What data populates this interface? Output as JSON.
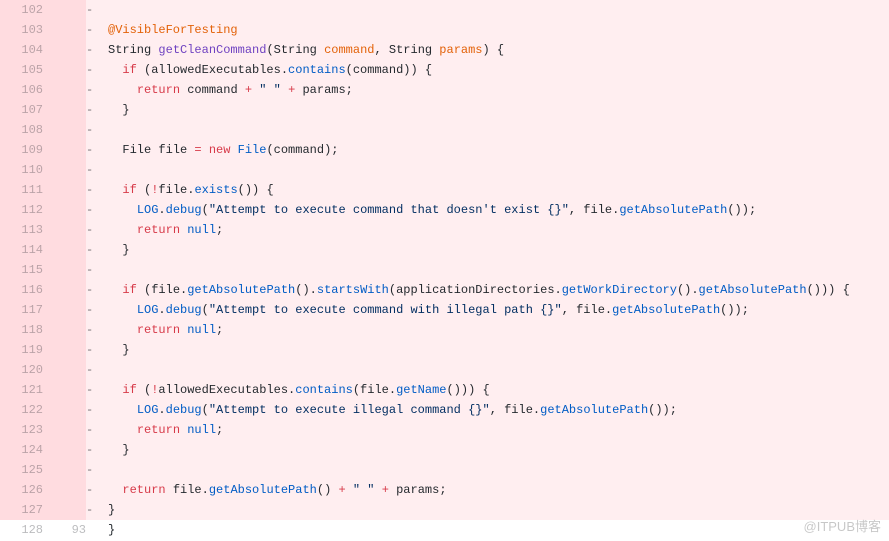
{
  "watermark": "@ITPUB博客",
  "rows": [
    {
      "ln_old": "102",
      "ln_new": "",
      "type": "del",
      "tokens": [
        [
          "marker",
          "-   "
        ]
      ]
    },
    {
      "ln_old": "103",
      "ln_new": "",
      "type": "del",
      "tokens": [
        [
          "marker",
          "-   "
        ],
        [
          "ann",
          "@VisibleForTesting"
        ]
      ]
    },
    {
      "ln_old": "104",
      "ln_new": "",
      "type": "del",
      "tokens": [
        [
          "marker",
          "-   "
        ],
        [
          "plain",
          "String "
        ],
        [
          "fn",
          "getCleanCommand"
        ],
        [
          "plain",
          "(String "
        ],
        [
          "param",
          "command"
        ],
        [
          "plain",
          ", String "
        ],
        [
          "param",
          "params"
        ],
        [
          "plain",
          ") {"
        ]
      ]
    },
    {
      "ln_old": "105",
      "ln_new": "",
      "type": "del",
      "tokens": [
        [
          "marker",
          "-   "
        ],
        [
          "plain",
          "  "
        ],
        [
          "ret",
          "if"
        ],
        [
          "plain",
          " (allowedExecutables."
        ],
        [
          "call",
          "contains"
        ],
        [
          "plain",
          "(command)) {"
        ]
      ]
    },
    {
      "ln_old": "106",
      "ln_new": "",
      "type": "del",
      "tokens": [
        [
          "marker",
          "-   "
        ],
        [
          "plain",
          "    "
        ],
        [
          "ret",
          "return"
        ],
        [
          "plain",
          " command "
        ],
        [
          "ret",
          "+"
        ],
        [
          "plain",
          " "
        ],
        [
          "str",
          "\" \""
        ],
        [
          "plain",
          " "
        ],
        [
          "ret",
          "+"
        ],
        [
          "plain",
          " params;"
        ]
      ]
    },
    {
      "ln_old": "107",
      "ln_new": "",
      "type": "del",
      "tokens": [
        [
          "marker",
          "-   "
        ],
        [
          "plain",
          "  }"
        ]
      ]
    },
    {
      "ln_old": "108",
      "ln_new": "",
      "type": "del",
      "tokens": [
        [
          "marker",
          "-   "
        ]
      ]
    },
    {
      "ln_old": "109",
      "ln_new": "",
      "type": "del",
      "tokens": [
        [
          "marker",
          "-   "
        ],
        [
          "plain",
          "  File file "
        ],
        [
          "ret",
          "="
        ],
        [
          "plain",
          " "
        ],
        [
          "ret",
          "new"
        ],
        [
          "plain",
          " "
        ],
        [
          "call",
          "File"
        ],
        [
          "plain",
          "(command);"
        ]
      ]
    },
    {
      "ln_old": "110",
      "ln_new": "",
      "type": "del",
      "tokens": [
        [
          "marker",
          "-   "
        ]
      ]
    },
    {
      "ln_old": "111",
      "ln_new": "",
      "type": "del",
      "tokens": [
        [
          "marker",
          "-   "
        ],
        [
          "plain",
          "  "
        ],
        [
          "ret",
          "if"
        ],
        [
          "plain",
          " ("
        ],
        [
          "ret",
          "!"
        ],
        [
          "plain",
          "file."
        ],
        [
          "call",
          "exists"
        ],
        [
          "plain",
          "()) {"
        ]
      ]
    },
    {
      "ln_old": "112",
      "ln_new": "",
      "type": "del",
      "tokens": [
        [
          "marker",
          "-   "
        ],
        [
          "plain",
          "    "
        ],
        [
          "call",
          "LOG"
        ],
        [
          "plain",
          "."
        ],
        [
          "call",
          "debug"
        ],
        [
          "plain",
          "("
        ],
        [
          "str",
          "\"Attempt to execute command that doesn't exist {}\""
        ],
        [
          "plain",
          ", file."
        ],
        [
          "call",
          "getAbsolutePath"
        ],
        [
          "plain",
          "());"
        ]
      ]
    },
    {
      "ln_old": "113",
      "ln_new": "",
      "type": "del",
      "tokens": [
        [
          "marker",
          "-   "
        ],
        [
          "plain",
          "    "
        ],
        [
          "ret",
          "return"
        ],
        [
          "plain",
          " "
        ],
        [
          "call",
          "null"
        ],
        [
          "plain",
          ";"
        ]
      ]
    },
    {
      "ln_old": "114",
      "ln_new": "",
      "type": "del",
      "tokens": [
        [
          "marker",
          "-   "
        ],
        [
          "plain",
          "  }"
        ]
      ]
    },
    {
      "ln_old": "115",
      "ln_new": "",
      "type": "del",
      "tokens": [
        [
          "marker",
          "-   "
        ]
      ]
    },
    {
      "ln_old": "116",
      "ln_new": "",
      "type": "del",
      "tokens": [
        [
          "marker",
          "-   "
        ],
        [
          "plain",
          "  "
        ],
        [
          "ret",
          "if"
        ],
        [
          "plain",
          " (file."
        ],
        [
          "call",
          "getAbsolutePath"
        ],
        [
          "plain",
          "()."
        ],
        [
          "call",
          "startsWith"
        ],
        [
          "plain",
          "(applicationDirectories."
        ],
        [
          "call",
          "getWorkDirectory"
        ],
        [
          "plain",
          "()."
        ],
        [
          "call",
          "getAbsolutePath"
        ],
        [
          "plain",
          "())) {"
        ]
      ]
    },
    {
      "ln_old": "117",
      "ln_new": "",
      "type": "del",
      "tokens": [
        [
          "marker",
          "-   "
        ],
        [
          "plain",
          "    "
        ],
        [
          "call",
          "LOG"
        ],
        [
          "plain",
          "."
        ],
        [
          "call",
          "debug"
        ],
        [
          "plain",
          "("
        ],
        [
          "str",
          "\"Attempt to execute command with illegal path {}\""
        ],
        [
          "plain",
          ", file."
        ],
        [
          "call",
          "getAbsolutePath"
        ],
        [
          "plain",
          "());"
        ]
      ]
    },
    {
      "ln_old": "118",
      "ln_new": "",
      "type": "del",
      "tokens": [
        [
          "marker",
          "-   "
        ],
        [
          "plain",
          "    "
        ],
        [
          "ret",
          "return"
        ],
        [
          "plain",
          " "
        ],
        [
          "call",
          "null"
        ],
        [
          "plain",
          ";"
        ]
      ]
    },
    {
      "ln_old": "119",
      "ln_new": "",
      "type": "del",
      "tokens": [
        [
          "marker",
          "-   "
        ],
        [
          "plain",
          "  }"
        ]
      ]
    },
    {
      "ln_old": "120",
      "ln_new": "",
      "type": "del",
      "tokens": [
        [
          "marker",
          "-   "
        ]
      ]
    },
    {
      "ln_old": "121",
      "ln_new": "",
      "type": "del",
      "tokens": [
        [
          "marker",
          "-   "
        ],
        [
          "plain",
          "  "
        ],
        [
          "ret",
          "if"
        ],
        [
          "plain",
          " ("
        ],
        [
          "ret",
          "!"
        ],
        [
          "plain",
          "allowedExecutables."
        ],
        [
          "call",
          "contains"
        ],
        [
          "plain",
          "(file."
        ],
        [
          "call",
          "getName"
        ],
        [
          "plain",
          "())) {"
        ]
      ]
    },
    {
      "ln_old": "122",
      "ln_new": "",
      "type": "del",
      "tokens": [
        [
          "marker",
          "-   "
        ],
        [
          "plain",
          "    "
        ],
        [
          "call",
          "LOG"
        ],
        [
          "plain",
          "."
        ],
        [
          "call",
          "debug"
        ],
        [
          "plain",
          "("
        ],
        [
          "str",
          "\"Attempt to execute illegal command {}\""
        ],
        [
          "plain",
          ", file."
        ],
        [
          "call",
          "getAbsolutePath"
        ],
        [
          "plain",
          "());"
        ]
      ]
    },
    {
      "ln_old": "123",
      "ln_new": "",
      "type": "del",
      "tokens": [
        [
          "marker",
          "-   "
        ],
        [
          "plain",
          "    "
        ],
        [
          "ret",
          "return"
        ],
        [
          "plain",
          " "
        ],
        [
          "call",
          "null"
        ],
        [
          "plain",
          ";"
        ]
      ]
    },
    {
      "ln_old": "124",
      "ln_new": "",
      "type": "del",
      "tokens": [
        [
          "marker",
          "-   "
        ],
        [
          "plain",
          "  }"
        ]
      ]
    },
    {
      "ln_old": "125",
      "ln_new": "",
      "type": "del",
      "tokens": [
        [
          "marker",
          "-   "
        ]
      ]
    },
    {
      "ln_old": "126",
      "ln_new": "",
      "type": "del",
      "tokens": [
        [
          "marker",
          "-   "
        ],
        [
          "plain",
          "  "
        ],
        [
          "ret",
          "return"
        ],
        [
          "plain",
          " file."
        ],
        [
          "call",
          "getAbsolutePath"
        ],
        [
          "plain",
          "() "
        ],
        [
          "ret",
          "+"
        ],
        [
          "plain",
          " "
        ],
        [
          "str",
          "\" \""
        ],
        [
          "plain",
          " "
        ],
        [
          "ret",
          "+"
        ],
        [
          "plain",
          " params;"
        ]
      ]
    },
    {
      "ln_old": "127",
      "ln_new": "",
      "type": "del",
      "tokens": [
        [
          "marker",
          "-   "
        ],
        [
          "plain",
          "}"
        ]
      ]
    },
    {
      "ln_old": "128",
      "ln_new": "93",
      "type": "ctx",
      "tokens": [
        [
          "marker",
          "    "
        ],
        [
          "plain",
          "}"
        ]
      ]
    }
  ]
}
